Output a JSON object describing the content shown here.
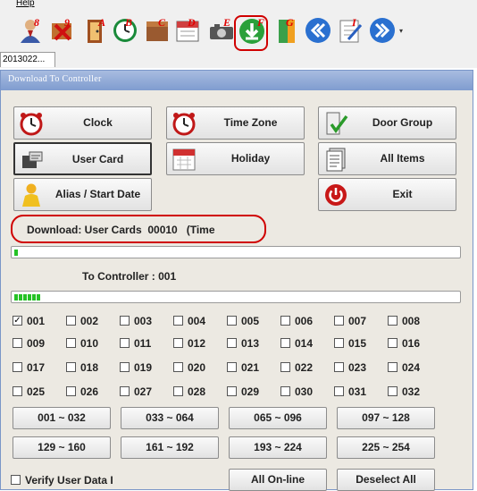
{
  "menu": {
    "help": "Help"
  },
  "toolbar": {
    "markers": [
      "8",
      "9",
      "A",
      "B",
      "C",
      "D",
      "E",
      "F",
      "G",
      "I"
    ],
    "icons": [
      "user-icon",
      "delete-icon",
      "door-icon",
      "clock-icon",
      "box-icon",
      "calendar-icon",
      "camera-icon",
      "download-icon",
      "door-green-icon",
      "back-icon",
      "edit-icon",
      "forward-icon"
    ]
  },
  "tab": {
    "label": "2013022..."
  },
  "dialog": {
    "title": "Download To Controller",
    "buttons": {
      "clock": "Clock",
      "time_zone": "Time Zone",
      "door_group": "Door Group",
      "user_card": "User Card",
      "holiday": "Holiday",
      "all_items": "All Items",
      "alias": "Alias / Start Date",
      "exit": "Exit"
    },
    "status": "Download: User Cards  00010   (Time",
    "progress1_fraction": 0.01,
    "controller_label": "To Controller : 001",
    "progress2_fraction": 0.06,
    "doors": [
      {
        "label": "001",
        "checked": true
      },
      {
        "label": "002",
        "checked": false
      },
      {
        "label": "003",
        "checked": false
      },
      {
        "label": "004",
        "checked": false
      },
      {
        "label": "005",
        "checked": false
      },
      {
        "label": "006",
        "checked": false
      },
      {
        "label": "007",
        "checked": false
      },
      {
        "label": "008",
        "checked": false
      },
      {
        "label": "009",
        "checked": false
      },
      {
        "label": "010",
        "checked": false
      },
      {
        "label": "011",
        "checked": false
      },
      {
        "label": "012",
        "checked": false
      },
      {
        "label": "013",
        "checked": false
      },
      {
        "label": "014",
        "checked": false
      },
      {
        "label": "015",
        "checked": false
      },
      {
        "label": "016",
        "checked": false
      },
      {
        "label": "017",
        "checked": false
      },
      {
        "label": "018",
        "checked": false
      },
      {
        "label": "019",
        "checked": false
      },
      {
        "label": "020",
        "checked": false
      },
      {
        "label": "021",
        "checked": false
      },
      {
        "label": "022",
        "checked": false
      },
      {
        "label": "023",
        "checked": false
      },
      {
        "label": "024",
        "checked": false
      },
      {
        "label": "025",
        "checked": false
      },
      {
        "label": "026",
        "checked": false
      },
      {
        "label": "027",
        "checked": false
      },
      {
        "label": "028",
        "checked": false
      },
      {
        "label": "029",
        "checked": false
      },
      {
        "label": "030",
        "checked": false
      },
      {
        "label": "031",
        "checked": false
      },
      {
        "label": "032",
        "checked": false
      }
    ],
    "ranges": [
      "001 ~ 032",
      "033 ~ 064",
      "065 ~ 096",
      "097 ~ 128",
      "129 ~ 160",
      "161 ~ 192",
      "193 ~ 224",
      "225 ~ 254"
    ],
    "verify_label": "Verify User Data I",
    "all_online": "All On-line",
    "deselect_all": "Deselect All"
  },
  "colors": {
    "highlight_ring": "#d00000",
    "progress": "#26c226",
    "title_bar": "#7f9ccf"
  }
}
